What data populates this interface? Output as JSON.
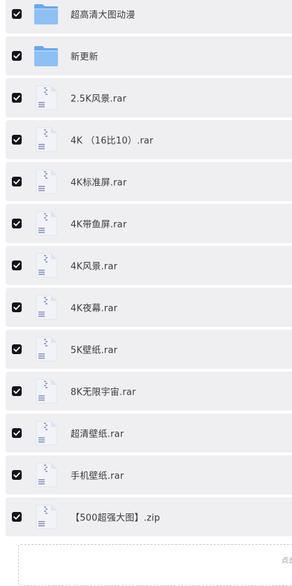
{
  "colors": {
    "row_background": "#efeff1",
    "checkbox_checked": "#14141c",
    "folder_blue": "#7fb4ef",
    "file_text": "#3a3a3f"
  },
  "files": [
    {
      "name": "超高清大图动漫",
      "type": "folder",
      "icon": "folder-icon",
      "checked": true
    },
    {
      "name": "新更新",
      "type": "folder",
      "icon": "folder-icon",
      "checked": true
    },
    {
      "name": "2.5K风景.rar",
      "type": "archive",
      "icon": "archive-file-icon",
      "checked": true
    },
    {
      "name": "4K （16比10）.rar",
      "type": "archive",
      "icon": "archive-file-icon",
      "checked": true
    },
    {
      "name": "4K标准屏.rar",
      "type": "archive",
      "icon": "archive-file-icon",
      "checked": true
    },
    {
      "name": "4K带鱼屏.rar",
      "type": "archive",
      "icon": "archive-file-icon",
      "checked": true
    },
    {
      "name": "4K风景.rar",
      "type": "archive",
      "icon": "archive-file-icon",
      "checked": true
    },
    {
      "name": "4K夜幕.rar",
      "type": "archive",
      "icon": "archive-file-icon",
      "checked": true
    },
    {
      "name": "5K壁纸.rar",
      "type": "archive",
      "icon": "archive-file-icon",
      "checked": true
    },
    {
      "name": "8K无限宇宙.rar",
      "type": "archive",
      "icon": "archive-file-icon",
      "checked": true
    },
    {
      "name": "超清壁纸.rar",
      "type": "archive",
      "icon": "archive-file-icon",
      "checked": true
    },
    {
      "name": "手机壁纸.rar",
      "type": "archive",
      "icon": "archive-file-icon",
      "checked": true
    },
    {
      "name": "【500超强大图】.zip",
      "type": "archive",
      "icon": "archive-file-icon",
      "checked": true
    }
  ],
  "upload_zone": {
    "hint": "点击"
  }
}
